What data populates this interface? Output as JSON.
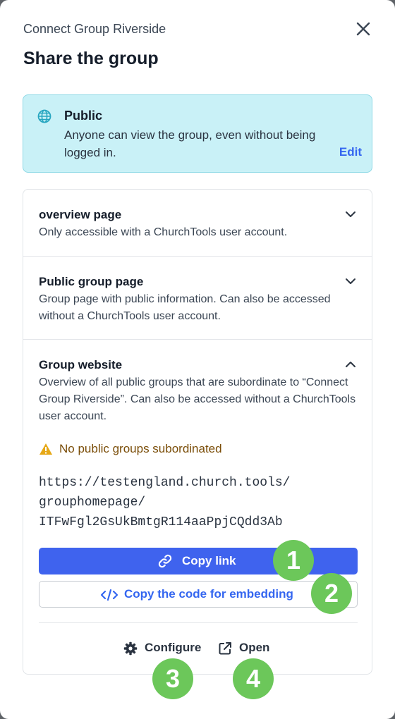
{
  "header": {
    "subtitle": "Connect Group Riverside",
    "title": "Share the group"
  },
  "visibility": {
    "title": "Public",
    "description": "Anyone can view the group, even without being logged in.",
    "edit_label": "Edit",
    "color": "#c9f1f7"
  },
  "sections": [
    {
      "title": "overview page",
      "description": "Only accessible with a ChurchTools user account.",
      "expanded": false
    },
    {
      "title": "Public group page",
      "description": "Group page with public information. Can also be accessed without a ChurchTools user account.",
      "expanded": false
    },
    {
      "title": "Group website",
      "description": "Overview of all public groups that are subordinate to “Connect Group Riverside”. Can also be accessed without a ChurchTools user account.",
      "expanded": true
    }
  ],
  "website": {
    "warning": "No public groups subordinated",
    "url_lines": [
      "https://testengland.church.tools/",
      "grouphomepage/",
      "ITFwFgl2GsUkBmtgR114aaPpjCQdd3Ab"
    ],
    "copy_link_label": "Copy link",
    "copy_embed_label": "Copy the code for embedding",
    "configure_label": "Configure",
    "open_label": "Open"
  },
  "badges": [
    "1",
    "2",
    "3",
    "4"
  ],
  "colors": {
    "primary": "#3f63ee",
    "link": "#3466f0",
    "badge": "#6cc75a",
    "warning": "#e6a817"
  }
}
